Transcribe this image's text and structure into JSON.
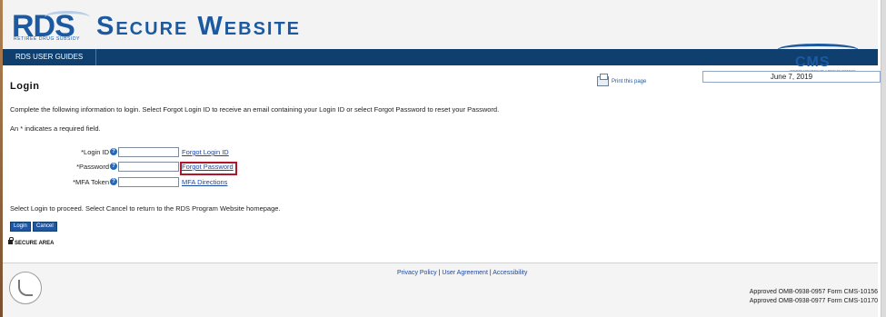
{
  "header": {
    "logo_text": "RDS",
    "logo_subtitle": "RETIREE DRUG SUBSIDY",
    "site_title": "Secure Website"
  },
  "nav": {
    "items": [
      {
        "label": "RDS USER GUIDES"
      }
    ]
  },
  "cms_logo": {
    "text": "CMS",
    "subtitle": "CENTERS FOR MEDICARE & MEDICAID SERVICES"
  },
  "date": "June 7, 2019",
  "print_link": "Print this page",
  "page_title": "Login",
  "instructions": "Complete the following information to login. Select Forgot Login ID to receive an email containing your Login ID or select Forgot Password to reset your Password.",
  "required_note": "An * indicates a required field.",
  "form": {
    "fields": [
      {
        "label": "*Login ID",
        "value": "",
        "link": "Forgot Login ID"
      },
      {
        "label": "*Password",
        "value": "",
        "link": "Forgot Password"
      },
      {
        "label": "*MFA Token",
        "value": "",
        "link": "MFA Directions"
      }
    ],
    "help_icon": "?"
  },
  "proceed_note": "Select Login to proceed. Select Cancel to return to the RDS Program Website homepage.",
  "buttons": {
    "login": "Login",
    "cancel": "Cancel"
  },
  "secure_area": "SECURE AREA",
  "footer": {
    "links": [
      {
        "label": "Privacy Policy"
      },
      {
        "label": "User Agreement"
      },
      {
        "label": "Accessibility"
      }
    ],
    "separator": "|",
    "approved": [
      "Approved OMB-0938-0957 Form CMS-10156",
      "Approved OMB-0938-0977 Form CMS-10170"
    ]
  },
  "colors": {
    "brand_blue": "#1b5aa0",
    "nav_bar": "#0e3f6e",
    "highlight_border": "#b0162a"
  },
  "icons": [
    "print-icon",
    "help-icon",
    "lock-icon",
    "hhs-logo"
  ]
}
